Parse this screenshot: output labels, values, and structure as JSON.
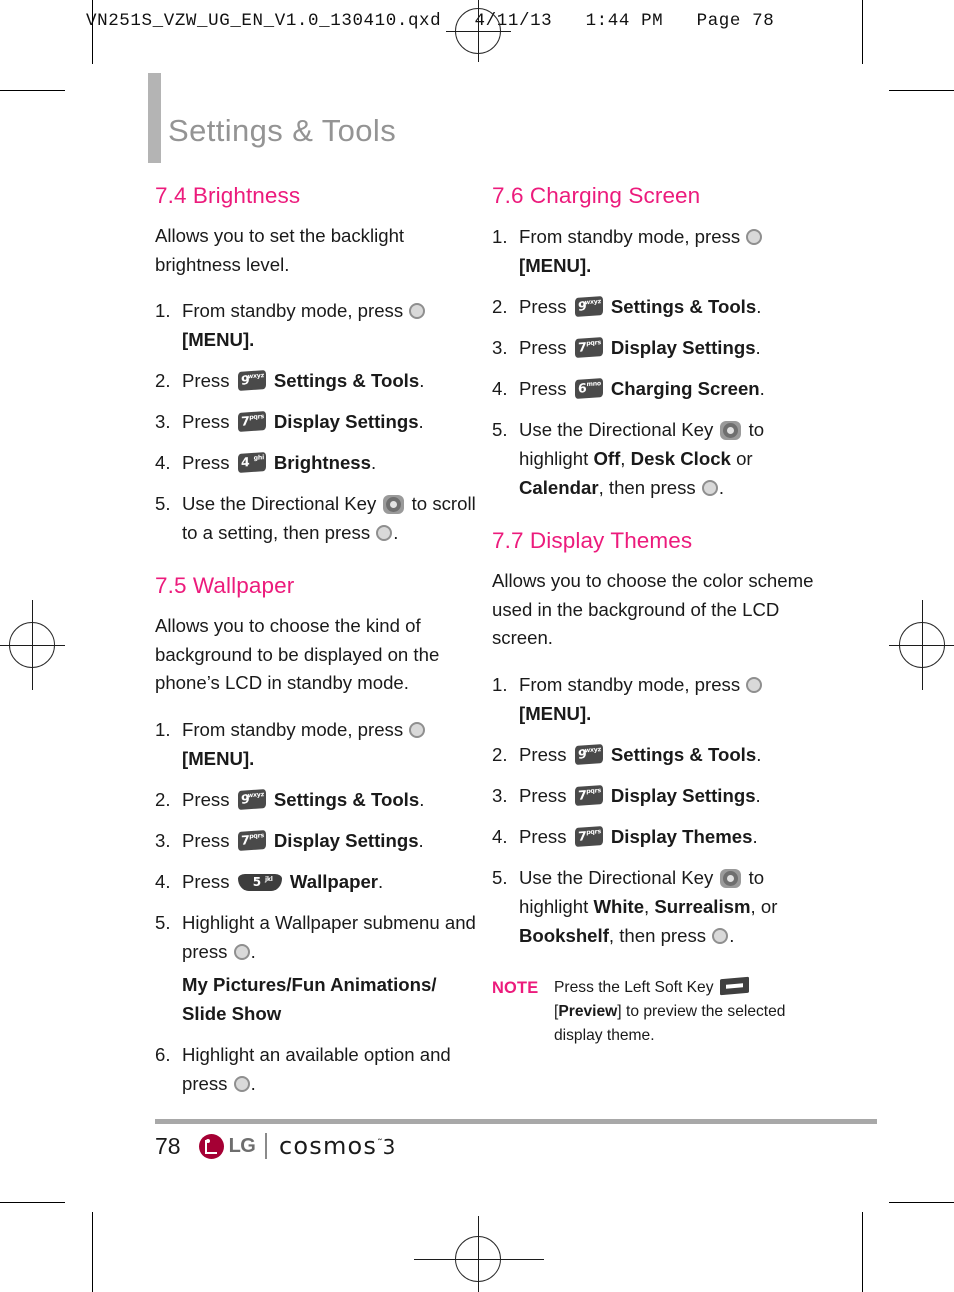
{
  "prepress": {
    "header_line": "VN251S_VZW_UG_EN_V1.0_130410.qxd   4/11/13   1:44 PM   Page 78"
  },
  "page": {
    "title": "Settings & Tools",
    "accent_color": "#ec1b7c",
    "title_color": "#949494",
    "page_number": "78"
  },
  "footer": {
    "page_number": "78",
    "brand": "LG",
    "product": "cosmos",
    "product_tm": "˜",
    "product_version": "3"
  },
  "sections": {
    "brightness": {
      "heading": "7.4 Brightness",
      "intro": "Allows you to set the backlight brightness level.",
      "steps": {
        "s1_num": "1.",
        "s1_a": "From standby mode, press",
        "s1_b": "[MENU].",
        "s2_num": "2.",
        "s2_a": "Press",
        "s2_key_digit": "9",
        "s2_key_letters": "wxyz",
        "s2_b": "Settings & Tools",
        "s2_c": ".",
        "s3_num": "3.",
        "s3_a": "Press",
        "s3_key_digit": "7",
        "s3_key_letters": "pqrs",
        "s3_b": "Display Settings",
        "s3_c": ".",
        "s4_num": "4.",
        "s4_a": "Press",
        "s4_key_digit": "4",
        "s4_key_letters": "ghi",
        "s4_b": "Brightness",
        "s4_c": ".",
        "s5_num": "5.",
        "s5_a": "Use the Directional Key",
        "s5_b": "to scroll to a setting, then press",
        "s5_c": "."
      }
    },
    "wallpaper": {
      "heading": "7.5 Wallpaper",
      "intro": "Allows you to choose the kind of background to be displayed on the phone’s LCD in standby mode.",
      "steps": {
        "s1_num": "1.",
        "s1_a": "From standby mode, press",
        "s1_b": "[MENU].",
        "s2_num": "2.",
        "s2_a": "Press",
        "s2_key_digit": "9",
        "s2_key_letters": "wxyz",
        "s2_b": "Settings & Tools",
        "s2_c": ".",
        "s3_num": "3.",
        "s3_a": "Press",
        "s3_key_digit": "7",
        "s3_key_letters": "pqrs",
        "s3_b": "Display Settings",
        "s3_c": ".",
        "s4_num": "4.",
        "s4_a": "Press",
        "s4_key_digit": "5",
        "s4_key_letters": "jkl",
        "s4_b": "Wallpaper",
        "s4_c": ".",
        "s5_num": "5.",
        "s5_a": "Highlight a Wallpaper submenu and press",
        "s5_c": ".",
        "s5_sub": "My Pictures/Fun Animations/ Slide Show",
        "s6_num": "6.",
        "s6_a": "Highlight an available option and press",
        "s6_c": "."
      }
    },
    "charging_screen": {
      "heading": "7.6 Charging Screen",
      "steps": {
        "s1_num": "1.",
        "s1_a": "From standby mode, press",
        "s1_b": "[MENU].",
        "s2_num": "2.",
        "s2_a": "Press",
        "s2_key_digit": "9",
        "s2_key_letters": "wxyz",
        "s2_b": "Settings & Tools",
        "s2_c": ".",
        "s3_num": "3.",
        "s3_a": "Press",
        "s3_key_digit": "7",
        "s3_key_letters": "pqrs",
        "s3_b": "Display Settings",
        "s3_c": ".",
        "s4_num": "4.",
        "s4_a": "Press",
        "s4_key_digit": "6",
        "s4_key_letters": "mno",
        "s4_b": "Charging Screen",
        "s4_c": ".",
        "s5_num": "5.",
        "s5_a": "Use the Directional Key",
        "s5_b": "to highlight",
        "s5_opt1": "Off",
        "s5_sep1": ",",
        "s5_opt2": "Desk Clock",
        "s5_sep2": "or",
        "s5_opt3": "Calendar",
        "s5_b2": ", then press",
        "s5_c": "."
      }
    },
    "display_themes": {
      "heading": "7.7 Display Themes",
      "intro": "Allows you to choose the color scheme used in the background of the LCD screen.",
      "steps": {
        "s1_num": "1.",
        "s1_a": "From standby mode, press",
        "s1_b": "[MENU].",
        "s2_num": "2.",
        "s2_a": "Press",
        "s2_key_digit": "9",
        "s2_key_letters": "wxyz",
        "s2_b": "Settings & Tools",
        "s2_c": ".",
        "s3_num": "3.",
        "s3_a": "Press",
        "s3_key_digit": "7",
        "s3_key_letters": "pqrs",
        "s3_b": "Display Settings",
        "s3_c": ".",
        "s4_num": "4.",
        "s4_a": "Press",
        "s4_key_digit": "7",
        "s4_key_letters": "pqrs",
        "s4_b": "Display Themes",
        "s4_c": ".",
        "s5_num": "5.",
        "s5_a": "Use the Directional Key",
        "s5_b": "to highlight",
        "s5_opt1": "White",
        "s5_sep1": ",",
        "s5_opt2": "Surrealism",
        "s5_sep2": ", or",
        "s5_opt3": "Bookshelf",
        "s5_b2": ", then press",
        "s5_c": "."
      },
      "note": {
        "label": "NOTE",
        "text_a": "Press the Left Soft Key",
        "bracket_open": "[",
        "bracket_label": "Preview",
        "bracket_close": "]",
        "text_b": "to preview the selected display theme."
      }
    }
  }
}
